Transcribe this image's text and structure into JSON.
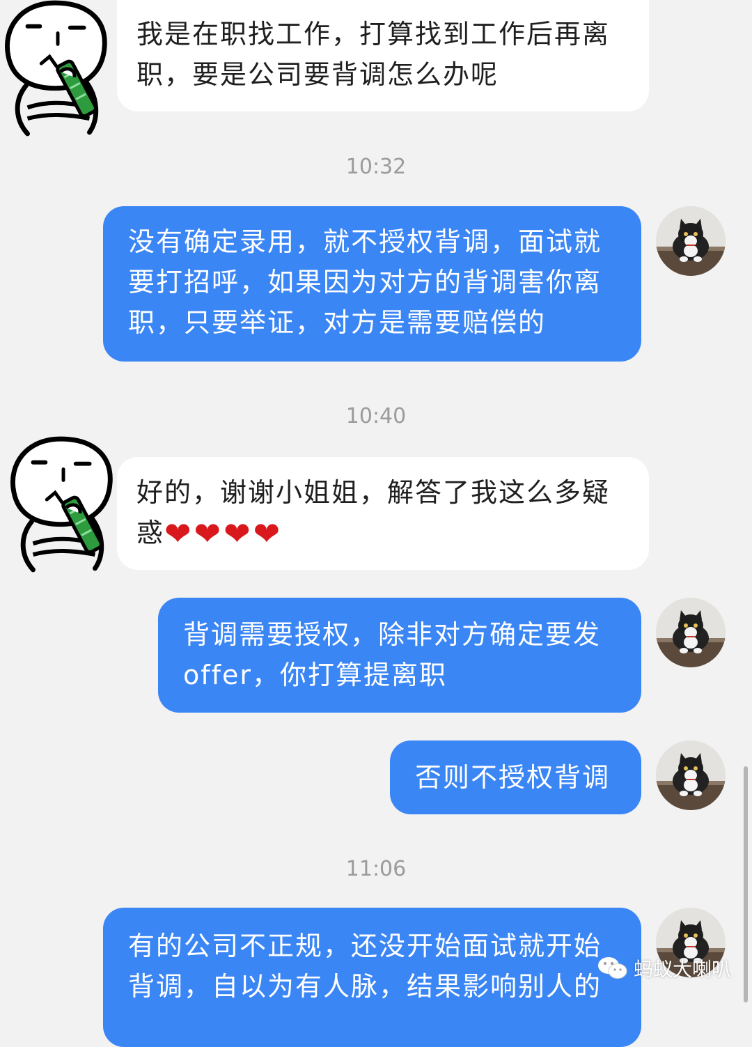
{
  "messages": [
    {
      "side": "in",
      "text": "我是在职找工作，打算找到工作后再离职，要是公司要背调怎么办呢"
    },
    {
      "side": "out",
      "text": "没有确定录用，就不授权背调，面试就要打招呼，如果因为对方的背调害你离职，只要举证，对方是需要赔偿的"
    },
    {
      "side": "in",
      "text": "好的，谢谢小姐姐，解答了我这么多疑惑",
      "suffix": "❤❤❤❤"
    },
    {
      "side": "out",
      "text": "背调需要授权，除非对方确定要发offer，你打算提离职"
    },
    {
      "side": "out",
      "text": "否则不授权背调"
    },
    {
      "side": "out",
      "text": "有的公司不正规，还没开始面试就开始背调，自以为有人脉，结果影响别人的"
    }
  ],
  "timestamps": [
    "10:32",
    "10:40",
    "11:06"
  ],
  "watermark": {
    "text": "蚂蚁大喇叭",
    "icon": "wechat-icon"
  },
  "colors": {
    "background": "#f2f2f2",
    "outgoing_bubble": "#3b86f5",
    "incoming_bubble": "#ffffff",
    "timestamp": "#9b9b9b",
    "heart": "#d8181c"
  },
  "icons": {
    "incoming_avatar": "cartoon-face-avatar-icon",
    "outgoing_avatar": "cat-photo-avatar"
  }
}
